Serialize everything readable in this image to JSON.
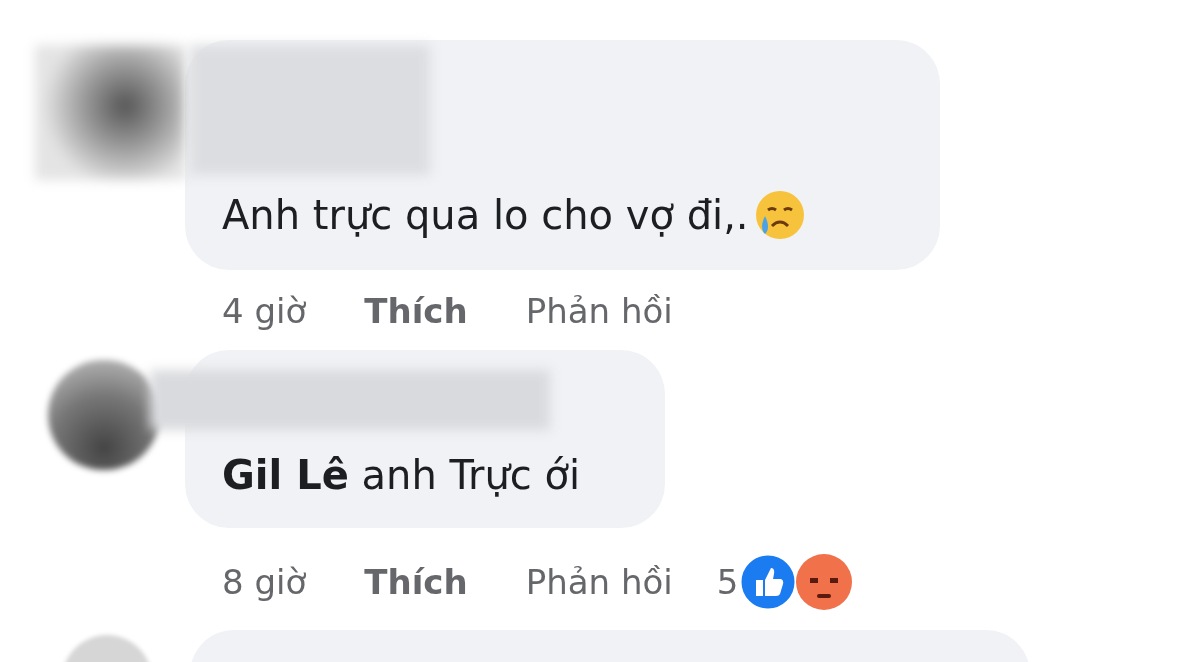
{
  "comments": [
    {
      "text": "Anh trực qua lo cho vợ đi,.",
      "has_emoji": true,
      "time": "4 giờ",
      "like": "Thích",
      "reply": "Phản hồi"
    },
    {
      "text": "**Gil Lê** anh Trực ới",
      "time": "8 giờ",
      "like": "Thích",
      "reply": "Phản hồi",
      "reaction_count": "5"
    }
  ]
}
